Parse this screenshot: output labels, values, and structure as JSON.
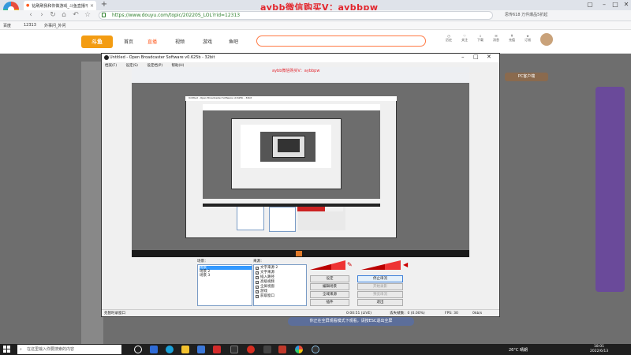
{
  "browser": {
    "tab_title": "钻刷刷我和你做游戏_斗鱼直播平...",
    "overlay_watermark": "aybb微信购买V：aybbpw",
    "url": "https://www.douyu.com/topic/20220S_LOL?rid=12313",
    "suggest_text": "思传618 万件爆品5折起",
    "bookmarks": [
      "百度",
      "12313",
      "外事问_外问"
    ]
  },
  "site": {
    "logo_text": "斗鱼",
    "nav": [
      "首页",
      "直播",
      "视频",
      "游戏",
      "鱼吧"
    ],
    "active_nav_index": 1,
    "header_icons": [
      "历史",
      "关注",
      "下载",
      "消息",
      "充值",
      "订阅"
    ],
    "side_badge": "PC客户端",
    "footer_banner": "你正在全屏观看模式下观看，请按ESC退出全屏"
  },
  "obs": {
    "title": "Untitled - Open Broadcaster Software v0.625b - 32bit",
    "menu": [
      "档案(F)",
      "设定(S)",
      "设定档(P)",
      "帮助(H)"
    ],
    "scenes_label": "场景：",
    "scenes": [
      "场景",
      "场景 2",
      "场景 3"
    ],
    "sources_label": "来源：",
    "sources": [
      "文字来源 2",
      "文字来源",
      "插入路径",
      "高级视频",
      "全屏视窗",
      "游戏",
      "获取窗口"
    ],
    "buttons": {
      "settings": "设定",
      "stop_stream": "停止串流",
      "edit_scene": "编辑场景",
      "start_recording": "开始录影",
      "global_sources": "全域来源",
      "preview_stream": "预览串流",
      "plugins": "插件",
      "exit": "退出"
    },
    "status": {
      "left": "先暂时录窗口",
      "time": "0:00:51 (LIVE)",
      "dropped": "丢失帧数：0 (0.00%)",
      "fps": "FPS: 30",
      "bitrate": "0kb/s"
    }
  },
  "taskbar": {
    "search_placeholder": "在这里输入你要搜索的内容",
    "weather": "26°C 晴朗",
    "time": "18:01",
    "date": "2022/6/13"
  },
  "colors": {
    "accent": "#ff5d23",
    "obs_sel": "#3399ff",
    "watermark": "#e3262d"
  }
}
